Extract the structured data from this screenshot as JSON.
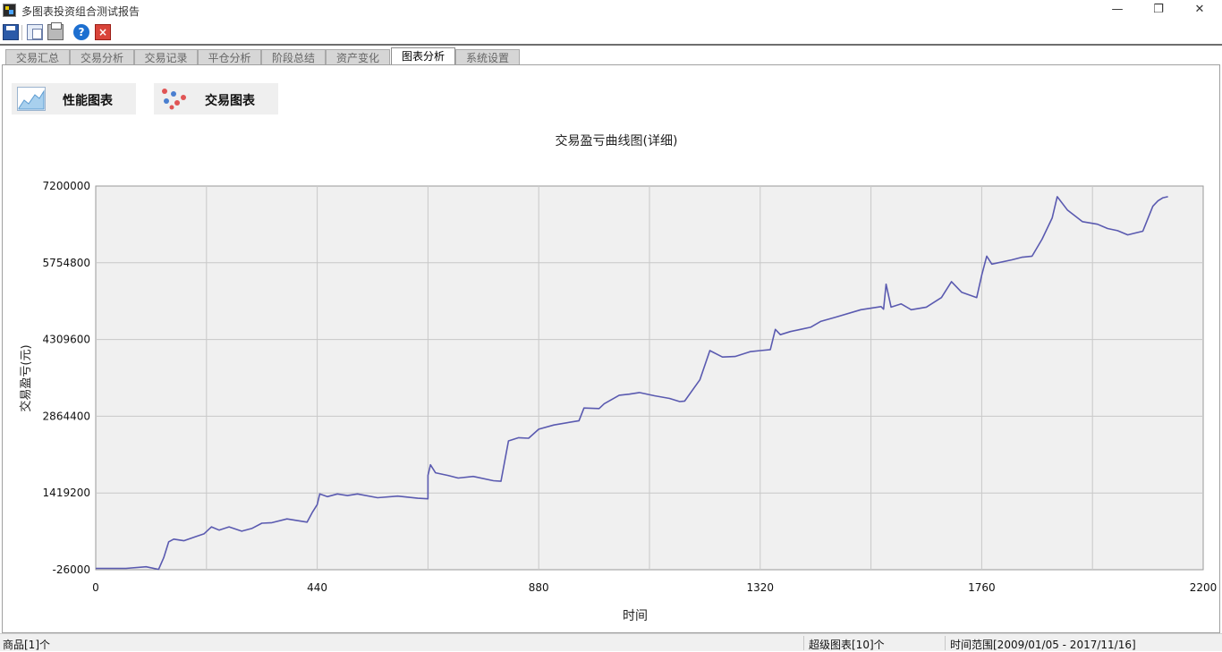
{
  "window": {
    "title": "多图表投资组合测试报告",
    "minimize_glyph": "—",
    "maximize_glyph": "❐",
    "close_glyph": "✕"
  },
  "toolbar": {
    "icons": [
      "save-icon",
      "copy-icon",
      "print-icon",
      "help-icon",
      "close-report-icon"
    ],
    "help_glyph": "?",
    "close_glyph": "×"
  },
  "tabs": [
    {
      "label": "交易汇总",
      "active": false
    },
    {
      "label": "交易分析",
      "active": false
    },
    {
      "label": "交易记录",
      "active": false
    },
    {
      "label": "平仓分析",
      "active": false
    },
    {
      "label": "阶段总结",
      "active": false
    },
    {
      "label": "资产变化",
      "active": false
    },
    {
      "label": "图表分析",
      "active": true
    },
    {
      "label": "系统设置",
      "active": false
    }
  ],
  "chart_buttons": {
    "performance": {
      "label": "性能图表",
      "icon": "area-chart-icon"
    },
    "trade": {
      "label": "交易图表",
      "icon": "scatter-dots-icon"
    }
  },
  "chart_data": {
    "type": "line",
    "title": "交易盈亏曲线图(详细)",
    "xlabel": "时间",
    "ylabel": "交易盈亏(元)",
    "xlim": [
      0,
      2200
    ],
    "ylim": [
      -26000,
      7200000
    ],
    "x_ticks": [
      "0",
      "440",
      "880",
      "1320",
      "1760",
      "2200"
    ],
    "y_ticks": [
      "-26000",
      "1419200",
      "2864400",
      "4309600",
      "5754800",
      "7200000"
    ],
    "grid": true,
    "line_color": "#5a5ab0",
    "series": [
      {
        "x": [
          0,
          60,
          100,
          125,
          135,
          145,
          155,
          175,
          200,
          215,
          230,
          245,
          265,
          290,
          310,
          330,
          350,
          380,
          420,
          430,
          440,
          445,
          460,
          480,
          500,
          520,
          560,
          600,
          640,
          660,
          660,
          665,
          675,
          700,
          720,
          750,
          790,
          805,
          820,
          840,
          860,
          880,
          910,
          960,
          970,
          1000,
          1010,
          1040,
          1060,
          1080,
          1110,
          1140,
          1160,
          1170,
          1200,
          1220,
          1245,
          1270,
          1300,
          1320,
          1340,
          1350,
          1360,
          1380,
          1400,
          1420,
          1440,
          1470,
          1520,
          1560,
          1565,
          1570,
          1580,
          1600,
          1620,
          1650,
          1680,
          1700,
          1720,
          1750,
          1760,
          1770,
          1780,
          1820,
          1840,
          1860,
          1880,
          1900,
          1910,
          1930,
          1960,
          1990,
          2000,
          2010,
          2030,
          2050,
          2080,
          2100,
          2110,
          2120,
          2130
        ],
        "y": [
          0,
          0,
          30000,
          -20000,
          200000,
          500000,
          550000,
          520000,
          600000,
          650000,
          780000,
          720000,
          780000,
          700000,
          750000,
          850000,
          860000,
          930000,
          870000,
          1050000,
          1200000,
          1400000,
          1350000,
          1400000,
          1370000,
          1400000,
          1330000,
          1360000,
          1320000,
          1310000,
          1750000,
          1950000,
          1800000,
          1750000,
          1700000,
          1730000,
          1650000,
          1640000,
          2400000,
          2460000,
          2450000,
          2620000,
          2700000,
          2780000,
          3020000,
          3010000,
          3100000,
          3260000,
          3280000,
          3310000,
          3250000,
          3200000,
          3140000,
          3150000,
          3550000,
          4100000,
          3980000,
          3990000,
          4080000,
          4100000,
          4120000,
          4500000,
          4400000,
          4460000,
          4500000,
          4540000,
          4650000,
          4730000,
          4870000,
          4930000,
          4880000,
          5350000,
          4920000,
          4980000,
          4870000,
          4920000,
          5100000,
          5400000,
          5200000,
          5100000,
          5520000,
          5880000,
          5730000,
          5810000,
          5860000,
          5880000,
          6200000,
          6600000,
          7000000,
          6750000,
          6530000,
          6480000,
          6440000,
          6400000,
          6360000,
          6280000,
          6350000,
          6820000,
          6920000,
          6980000,
          7000000
        ]
      }
    ]
  },
  "status": {
    "product": "商品[1]个",
    "super_charts": "超级图表[10]个",
    "time_range": "时间范围[2009/01/05 - 2017/11/16]"
  }
}
